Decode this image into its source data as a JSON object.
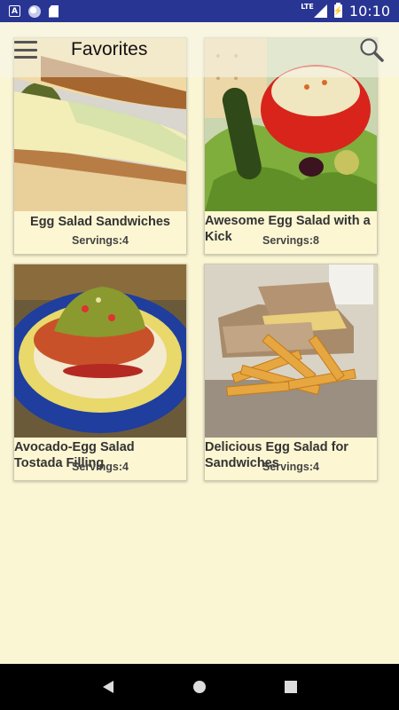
{
  "status_bar": {
    "network": "LTE",
    "time": "10:10",
    "icons": [
      "a-notification-icon",
      "circle-notification-icon",
      "sd-card-icon",
      "signal-icon",
      "battery-charging-icon"
    ]
  },
  "toolbar": {
    "title": "Favorites",
    "menu_icon": "hamburger-menu-icon",
    "search_icon": "search-icon"
  },
  "recipes": [
    {
      "title": "Egg Salad Sandwiches",
      "servings": "Servings:4",
      "image": "egg-salad-sandwich-photo"
    },
    {
      "title": "Awesome Egg Salad with a Kick",
      "servings": "Servings:8",
      "image": "stuffed-tomato-photo"
    },
    {
      "title": "Avocado-Egg Salad Tostada Filling",
      "servings": "Servings:4",
      "image": "tostada-photo"
    },
    {
      "title": "Delicious Egg Salad for Sandwiches",
      "servings": "Servings:4",
      "image": "sandwich-with-fries-photo"
    }
  ],
  "nav_bar": {
    "back": "back-icon",
    "home": "home-icon",
    "recents": "recents-icon"
  },
  "colors": {
    "status_bar": "#283593",
    "background": "#FAF6D4",
    "card": "#FCF6D2"
  }
}
